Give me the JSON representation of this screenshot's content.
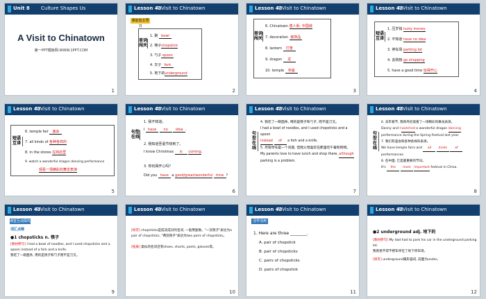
{
  "slides": [
    {
      "num": "1",
      "unit": "Unit 8",
      "unit_title": "Culture Shapes Us",
      "title": "A Visit to Chinatown",
      "site": "第一PPT模板网-WWW.1PPT.COM"
    },
    {
      "num": "2",
      "lesson": "Lesson 43",
      "lesson_title": "A Visit to Chinatown",
      "tag": "课前自主预习",
      "side": "单词闯关",
      "items": [
        "1. 碗 ",
        "2. 筷子",
        "3. 勺子",
        "4. 叉子",
        "5. 地下的"
      ],
      "answers": [
        "bowl",
        "chopstick",
        "spoon",
        "fork",
        "underground"
      ]
    },
    {
      "num": "3",
      "lesson": "Lesson 43",
      "lesson_title": "A Visit to Chinatown",
      "side": "单词闯关",
      "items": [
        "6. Chinatown",
        "7. decoration",
        "8. lantern",
        "9. dragon",
        "10. temple"
      ],
      "answers": [
        "唐人街; 中国城",
        "装饰品",
        "灯笼",
        "龙",
        "寺庙"
      ]
    },
    {
      "num": "4",
      "lesson": "Lesson 43",
      "lesson_title": "A Visit to Chinatown",
      "side": "短语互译",
      "items": [
        "1. 压岁钱",
        "2. 不知道",
        "3. 停车场",
        "4. 去购物",
        "5. have a good time"
      ],
      "answers": [
        "lucky money",
        "have no idea",
        "parking lot",
        "go shopping",
        "玩得开心"
      ]
    },
    {
      "num": "5",
      "lesson": "Lesson 43",
      "lesson_title": "A Visit to Chinatown",
      "side": "短语互译",
      "items": [
        "6. temple fair",
        "7. all kinds of",
        "8. in the stores",
        "9. watch a wonderful dragon dancing performance"
      ],
      "answers": [
        "庙会",
        "各种各样的",
        "在商店里",
        "观看一场精彩的舞龙表演"
      ]
    },
    {
      "num": "6",
      "lesson": "Lesson 43",
      "lesson_title": "A Visit to Chinatown",
      "side": "句型在线",
      "lines": [
        "1. 我不知道。",
        "I ____ ____ ____.",
        "2. 我知道圣诞节快到了。",
        "I know Christmas ____ ____.",
        "3. 你玩得开心吗?",
        "Did you ____ a ____ time?"
      ],
      "answers": [
        "have",
        "no",
        "idea",
        "is",
        "coming",
        "have",
        "good/great/wonderful",
        "time"
      ]
    },
    {
      "num": "7",
      "lesson": "Lesson 43",
      "lesson_title": "A Visit to Chinatown",
      "side": "句型在线",
      "lines": [
        "4. 我吃了一碗面条, 用的是筷子和勺子, 而不是刀叉。",
        "I had a bowl of noodles, and I used chopsticks and a spoon",
        "____ ____ a fork and a knife.",
        "5. 尽管停车是一个问题, 但我父母喜欢在那里吃午餐和购物。",
        "My parents love to have lunch and shop there, ____",
        "parking is a problem."
      ],
      "answers": [
        "instead",
        "of",
        "although"
      ]
    },
    {
      "num": "8",
      "lesson": "Lesson 43",
      "lesson_title": "A Visit to Chinatown",
      "side": "句型在线",
      "lines": [
        "6. 去年春节, 我和丹尼观看了一场精彩的舞龙表演。",
        "Danny and I ____ a wonderful dragon ____",
        "performance during the Spring Festival last year.",
        "7. 我们有庙会和各种各样的表演。",
        "We have temple fairs and ____ ____ ____",
        "performances.",
        "8. 在中国, 它是最重要的节日。",
        "It's ____ ____ ____ festival in China."
      ],
      "answers": [
        "watched",
        "dancing",
        "all",
        "kinds",
        "of",
        "the",
        "most",
        "important"
      ]
    },
    {
      "num": "9",
      "lesson": "Lesson 43",
      "lesson_title": "A Visit to Chinatown",
      "tag": "课堂互动探究",
      "sub": "词汇点睛",
      "point": "●1  chopsticks n. 筷子",
      "label": "[教材原句]",
      "text1": "I had a bowl of noodles, and I used chopsticks and a spoon instead of a fork and a knife.",
      "text2": "我吃了一碗面条, 用的是筷子和勺子而不是刀叉。"
    },
    {
      "num": "10",
      "lesson": "Lesson 43",
      "lesson_title": "A Visit to Chinatown",
      "label1": "[探究]",
      "text1": "chopsticks是成双成对的名词, 一般用复数。\"一双筷子\"表达为a pair of chopsticks, \"两双筷子\"表达为two pairs of chopsticks。",
      "label2": "[拓展]",
      "text2": "类似的名词还有shoes, shorts, pants, glasses等。"
    },
    {
      "num": "11",
      "lesson": "Lesson 43",
      "lesson_title": "A Visit to Chinatown",
      "tag": "活学活用",
      "q": "1. Here are three ________.",
      "options": [
        "A. pair of chopstick",
        "B. pair of chopsticks",
        "C. pairs of chopsticks",
        "D. pairs of chopstick"
      ]
    },
    {
      "num": "12",
      "lesson": "Lesson 43",
      "lesson_title": "A Visit to Chinatown",
      "point": "●2  underground  adj. 地下的",
      "label": "[教材原句]",
      "text1": "My dad had to park his car in the underground parking lot.",
      "text2": "我爸爸不得不把车停在了地下停车场。",
      "label2": "[探究]",
      "text3": "underground属形容词, 前面为under。"
    }
  ]
}
